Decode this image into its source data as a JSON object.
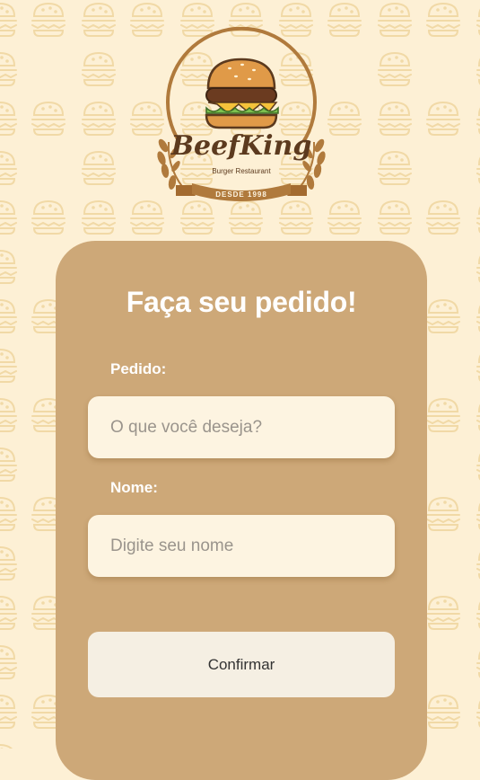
{
  "logo": {
    "brand_name": "BeefKing",
    "tagline": "Burger Restaurant",
    "ribbon_text": "DESDE 1998"
  },
  "form": {
    "title": "Faça seu pedido!",
    "order_label": "Pedido:",
    "order_placeholder": "O que você deseja?",
    "order_value": "",
    "name_label": "Nome:",
    "name_placeholder": "Digite seu nome",
    "name_value": "",
    "confirm_label": "Confirmar"
  },
  "colors": {
    "background": "#fdf0d5",
    "pattern_icon": "#f1d9a6",
    "card": "#cda878",
    "input_bg": "#fdf4e1",
    "button_bg": "#f5efe3",
    "logo_brown": "#5c3a1e",
    "logo_ring": "#b07a3c"
  }
}
